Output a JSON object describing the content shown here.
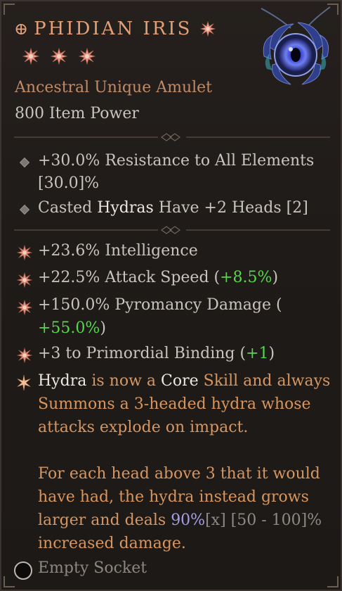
{
  "item": {
    "title_prefix": "⊕",
    "title": "PHIDIAN IRIS",
    "type": "Ancestral Unique Amulet",
    "power": "800 Item Power"
  },
  "implicits": [
    {
      "line1": "+30.0% Resistance to All Elements",
      "line2": "[30.0]%"
    },
    {
      "pre": "Casted ",
      "hl": "Hydras",
      "post": " Have +2 Heads [2]"
    }
  ],
  "affixes": [
    {
      "text": "+23.6% Intelligence"
    },
    {
      "text": "+22.5% Attack Speed (",
      "green": "+8.5%",
      "tail": ")"
    },
    {
      "text": "+150.0% Pyromancy Damage (",
      "green": "+55.0%",
      "tail": ")"
    },
    {
      "text": "+3 to Primordial Binding (",
      "green": "+1",
      "tail": ")"
    }
  ],
  "unique": {
    "w1": "Hydra",
    "w2": " is now a ",
    "w3": "Core",
    "w4": " Skill",
    "w5": " and always",
    "line2": "Summons a 3-headed hydra whose",
    "line3": "attacks explode on impact.",
    "line4": "For each head above 3 that it would",
    "line5": "have had, the hydra instead grows",
    "line6a": "larger and deals ",
    "line6b": "90%",
    "line6c": "[x]",
    "line6d": " [50 - 100]%",
    "line7": "increased damage."
  },
  "socket": {
    "label": "Empty Socket"
  },
  "colors": {
    "unique_title": "#e3a078",
    "item_type": "#c08b66",
    "bonus_green": "#56d64b",
    "unique_text": "#d8965f",
    "roll_purple": "#a79ee8"
  }
}
